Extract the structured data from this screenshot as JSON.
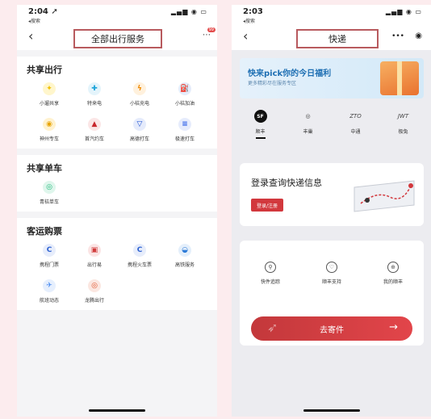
{
  "left": {
    "status": {
      "time": "2:04 ➚",
      "back": "◂搜索",
      "icons": "▂▄▆ ◉ ▭"
    },
    "nav": {
      "back": "‹",
      "title": "全部出行服务",
      "badge": "99"
    },
    "sections": [
      {
        "title": "共享出行",
        "items": [
          {
            "label": "小遛共享",
            "glyph": "✦",
            "color": "#f0c000",
            "bg": "#fff6cc"
          },
          {
            "label": "特来电",
            "glyph": "✚",
            "color": "#1aa3d9",
            "bg": "#e4f4fb"
          },
          {
            "label": "小桔充电",
            "glyph": "ϟ",
            "color": "#f08a00",
            "bg": "#fff1dd"
          },
          {
            "label": "小桔加油",
            "glyph": "⛽",
            "color": "#2b63c9",
            "bg": "#e5ecfa"
          },
          {
            "label": "神州专车",
            "glyph": "◉",
            "color": "#e8a400",
            "bg": "#fff2cf"
          },
          {
            "label": "首汽约车",
            "glyph": "▲",
            "color": "#c8262c",
            "bg": "#fbe6e6"
          },
          {
            "label": "高德打车",
            "glyph": "▽",
            "color": "#1a4fd1",
            "bg": "#e5ebfb"
          },
          {
            "label": "极速打车",
            "glyph": "≡",
            "color": "#2c5ee8",
            "bg": "#e6ecfc"
          }
        ]
      },
      {
        "title": "共享单车",
        "items": [
          {
            "label": "青桔单车",
            "glyph": "◎",
            "color": "#1eb97a",
            "bg": "#dff6ec"
          }
        ]
      },
      {
        "title": "客运购票",
        "items": [
          {
            "label": "携程门票",
            "glyph": "C",
            "color": "#2e62d1",
            "bg": "#e7edfb"
          },
          {
            "label": "出行易",
            "glyph": "▣",
            "color": "#d13d3d",
            "bg": "#fbe5e5"
          },
          {
            "label": "携程火车票",
            "glyph": "C",
            "color": "#2e62d1",
            "bg": "#e7edfb"
          },
          {
            "label": "高铁服务",
            "glyph": "◒",
            "color": "#2c7bd8",
            "bg": "#e4effb"
          },
          {
            "label": "航班动态",
            "glyph": "✈",
            "color": "#4c8df2",
            "bg": "#e6effd"
          },
          {
            "label": "龙腾出行",
            "glyph": "◎",
            "color": "#e0522b",
            "bg": "#fbe7e1"
          }
        ]
      }
    ]
  },
  "right": {
    "status": {
      "time": "2:03",
      "back": "◂搜索",
      "icons": "▂▄▆ ◉ ▭"
    },
    "nav": {
      "back": "‹",
      "title": "快递",
      "more": "•••",
      "target": "◉"
    },
    "banner": {
      "title": "快来pick你的今日福利",
      "subtitle": "更多精彩尽在服务专区"
    },
    "couriers": [
      {
        "logo": "SF",
        "name": "顺丰"
      },
      {
        "logo": "◎",
        "name": "丰巢"
      },
      {
        "logo": "ZTO",
        "name": "中通"
      },
      {
        "logo": "JWT",
        "name": "极兔"
      }
    ],
    "login": {
      "title": "登录查询快递信息",
      "button": "登录/注册"
    },
    "services": [
      {
        "icon": "⚲",
        "label": "快件追踪"
      },
      {
        "icon": "♡",
        "label": "顺丰支持"
      },
      {
        "icon": "⊕",
        "label": "我的顺丰"
      }
    ],
    "send": {
      "label": "去寄件",
      "arrow": "→",
      "plane": "➶"
    }
  }
}
